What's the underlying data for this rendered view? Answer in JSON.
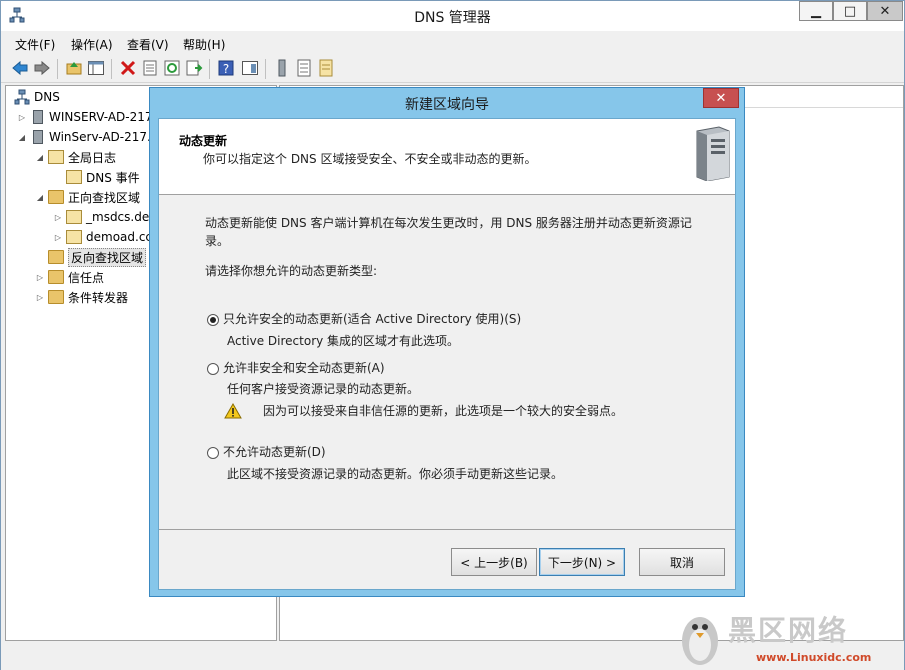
{
  "window": {
    "title": "DNS 管理器"
  },
  "menu": [
    "文件(F)",
    "操作(A)",
    "查看(V)",
    "帮助(H)"
  ],
  "tree": {
    "root": "DNS",
    "server1": "WINSERV-AD-217",
    "server2": "WinServ-AD-217.",
    "global_logs": "全局日志",
    "dns_events": "DNS 事件",
    "forward_zones": "正向查找区域",
    "msdcs": "_msdcs.de",
    "demoad": "demoad.cc",
    "reverse_zones": "反向查找区域",
    "trust_points": "信任点",
    "conditional_forwarders": "条件转发器"
  },
  "dialog": {
    "title": "新建区域向导",
    "header_title": "动态更新",
    "header_subtitle": "你可以指定这个 DNS 区域接受安全、不安全或非动态的更新。",
    "intro_line1": "动态更新能使 DNS 客户端计算机在每次发生更改时，用 DNS 服务器注册并动态更新资源记",
    "intro_line2": "录。",
    "choose_label": "请选择你想允许的动态更新类型:",
    "option1_label": "只允许安全的动态更新(适合 Active Directory 使用)(S)",
    "option1_desc": "Active Directory 集成的区域才有此选项。",
    "option2_label": "允许非安全和安全动态更新(A)",
    "option2_desc": "任何客户接受资源记录的动态更新。",
    "option2_warning": "因为可以接受来自非信任源的更新，此选项是一个较大的安全弱点。",
    "option3_label": "不允许动态更新(D)",
    "option3_desc": "此区域不接受资源记录的动态更新。你必须手动更新这些记录。",
    "selected_option": 1,
    "back_button": "< 上一步(B)",
    "next_button": "下一步(N) >",
    "cancel_button": "取消"
  },
  "watermark": {
    "brand": "黑区网络",
    "url": "www.Linuxidc.com"
  }
}
